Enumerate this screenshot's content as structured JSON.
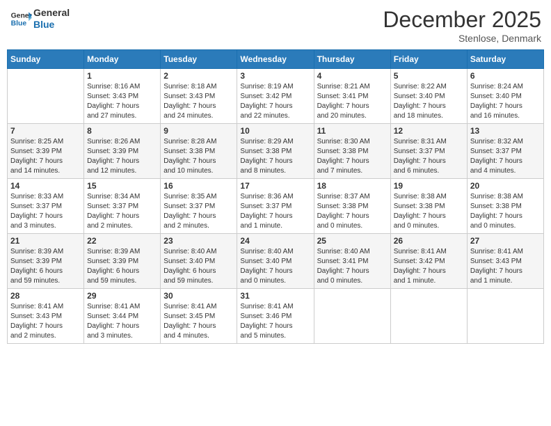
{
  "header": {
    "logo_line1": "General",
    "logo_line2": "Blue",
    "month_title": "December 2025",
    "location": "Stenlose, Denmark"
  },
  "weekdays": [
    "Sunday",
    "Monday",
    "Tuesday",
    "Wednesday",
    "Thursday",
    "Friday",
    "Saturday"
  ],
  "weeks": [
    [
      {
        "day": "",
        "info": ""
      },
      {
        "day": "1",
        "info": "Sunrise: 8:16 AM\nSunset: 3:43 PM\nDaylight: 7 hours\nand 27 minutes."
      },
      {
        "day": "2",
        "info": "Sunrise: 8:18 AM\nSunset: 3:43 PM\nDaylight: 7 hours\nand 24 minutes."
      },
      {
        "day": "3",
        "info": "Sunrise: 8:19 AM\nSunset: 3:42 PM\nDaylight: 7 hours\nand 22 minutes."
      },
      {
        "day": "4",
        "info": "Sunrise: 8:21 AM\nSunset: 3:41 PM\nDaylight: 7 hours\nand 20 minutes."
      },
      {
        "day": "5",
        "info": "Sunrise: 8:22 AM\nSunset: 3:40 PM\nDaylight: 7 hours\nand 18 minutes."
      },
      {
        "day": "6",
        "info": "Sunrise: 8:24 AM\nSunset: 3:40 PM\nDaylight: 7 hours\nand 16 minutes."
      }
    ],
    [
      {
        "day": "7",
        "info": "Sunrise: 8:25 AM\nSunset: 3:39 PM\nDaylight: 7 hours\nand 14 minutes."
      },
      {
        "day": "8",
        "info": "Sunrise: 8:26 AM\nSunset: 3:39 PM\nDaylight: 7 hours\nand 12 minutes."
      },
      {
        "day": "9",
        "info": "Sunrise: 8:28 AM\nSunset: 3:38 PM\nDaylight: 7 hours\nand 10 minutes."
      },
      {
        "day": "10",
        "info": "Sunrise: 8:29 AM\nSunset: 3:38 PM\nDaylight: 7 hours\nand 8 minutes."
      },
      {
        "day": "11",
        "info": "Sunrise: 8:30 AM\nSunset: 3:38 PM\nDaylight: 7 hours\nand 7 minutes."
      },
      {
        "day": "12",
        "info": "Sunrise: 8:31 AM\nSunset: 3:37 PM\nDaylight: 7 hours\nand 6 minutes."
      },
      {
        "day": "13",
        "info": "Sunrise: 8:32 AM\nSunset: 3:37 PM\nDaylight: 7 hours\nand 4 minutes."
      }
    ],
    [
      {
        "day": "14",
        "info": "Sunrise: 8:33 AM\nSunset: 3:37 PM\nDaylight: 7 hours\nand 3 minutes."
      },
      {
        "day": "15",
        "info": "Sunrise: 8:34 AM\nSunset: 3:37 PM\nDaylight: 7 hours\nand 2 minutes."
      },
      {
        "day": "16",
        "info": "Sunrise: 8:35 AM\nSunset: 3:37 PM\nDaylight: 7 hours\nand 2 minutes."
      },
      {
        "day": "17",
        "info": "Sunrise: 8:36 AM\nSunset: 3:37 PM\nDaylight: 7 hours\nand 1 minute."
      },
      {
        "day": "18",
        "info": "Sunrise: 8:37 AM\nSunset: 3:38 PM\nDaylight: 7 hours\nand 0 minutes."
      },
      {
        "day": "19",
        "info": "Sunrise: 8:38 AM\nSunset: 3:38 PM\nDaylight: 7 hours\nand 0 minutes."
      },
      {
        "day": "20",
        "info": "Sunrise: 8:38 AM\nSunset: 3:38 PM\nDaylight: 7 hours\nand 0 minutes."
      }
    ],
    [
      {
        "day": "21",
        "info": "Sunrise: 8:39 AM\nSunset: 3:39 PM\nDaylight: 6 hours\nand 59 minutes."
      },
      {
        "day": "22",
        "info": "Sunrise: 8:39 AM\nSunset: 3:39 PM\nDaylight: 6 hours\nand 59 minutes."
      },
      {
        "day": "23",
        "info": "Sunrise: 8:40 AM\nSunset: 3:40 PM\nDaylight: 6 hours\nand 59 minutes."
      },
      {
        "day": "24",
        "info": "Sunrise: 8:40 AM\nSunset: 3:40 PM\nDaylight: 7 hours\nand 0 minutes."
      },
      {
        "day": "25",
        "info": "Sunrise: 8:40 AM\nSunset: 3:41 PM\nDaylight: 7 hours\nand 0 minutes."
      },
      {
        "day": "26",
        "info": "Sunrise: 8:41 AM\nSunset: 3:42 PM\nDaylight: 7 hours\nand 1 minute."
      },
      {
        "day": "27",
        "info": "Sunrise: 8:41 AM\nSunset: 3:43 PM\nDaylight: 7 hours\nand 1 minute."
      }
    ],
    [
      {
        "day": "28",
        "info": "Sunrise: 8:41 AM\nSunset: 3:43 PM\nDaylight: 7 hours\nand 2 minutes."
      },
      {
        "day": "29",
        "info": "Sunrise: 8:41 AM\nSunset: 3:44 PM\nDaylight: 7 hours\nand 3 minutes."
      },
      {
        "day": "30",
        "info": "Sunrise: 8:41 AM\nSunset: 3:45 PM\nDaylight: 7 hours\nand 4 minutes."
      },
      {
        "day": "31",
        "info": "Sunrise: 8:41 AM\nSunset: 3:46 PM\nDaylight: 7 hours\nand 5 minutes."
      },
      {
        "day": "",
        "info": ""
      },
      {
        "day": "",
        "info": ""
      },
      {
        "day": "",
        "info": ""
      }
    ]
  ]
}
